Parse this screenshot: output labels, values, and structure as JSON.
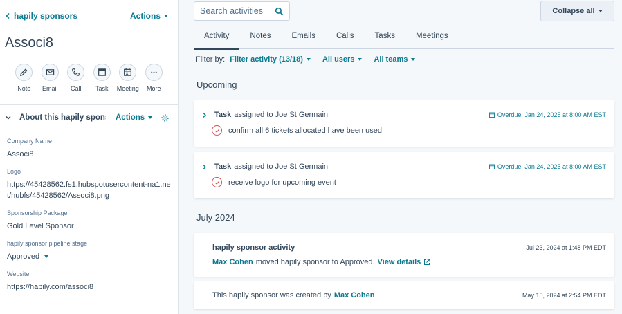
{
  "sidebar": {
    "back_label": "hapily sponsors",
    "actions_label": "Actions",
    "record_name": "Associ8",
    "quick_actions": [
      {
        "label": "Note",
        "icon": "note-icon"
      },
      {
        "label": "Email",
        "icon": "email-icon"
      },
      {
        "label": "Call",
        "icon": "call-icon"
      },
      {
        "label": "Task",
        "icon": "task-icon"
      },
      {
        "label": "Meeting",
        "icon": "meeting-icon"
      },
      {
        "label": "More",
        "icon": "more-icon"
      }
    ],
    "about": {
      "title": "About this hapily sponsor",
      "actions_label": "Actions"
    },
    "properties": [
      {
        "label": "Company Name",
        "value": "Associ8"
      },
      {
        "label": "Logo",
        "value": "https://45428562.fs1.hubspotusercontent-na1.net/hubfs/45428562/Associ8.png"
      },
      {
        "label": "Sponsorship Package",
        "value": "Gold Level Sponsor"
      },
      {
        "label": "hapily sponsor pipeline stage",
        "value": "Approved"
      },
      {
        "label": "Website",
        "value": "https://hapily.com/associ8"
      }
    ]
  },
  "main": {
    "search_placeholder": "Search activities",
    "collapse_label": "Collapse all",
    "tabs": [
      "Activity",
      "Notes",
      "Emails",
      "Calls",
      "Tasks",
      "Meetings"
    ],
    "active_tab": "Activity",
    "filter_by_label": "Filter by:",
    "filters": [
      "Filter activity (13/18)",
      "All users",
      "All teams"
    ],
    "sections": {
      "upcoming": "Upcoming",
      "july": "July 2024"
    },
    "tasks": [
      {
        "kind": "Task",
        "assigned_text": "assigned to Joe St Germain",
        "due": "Overdue: Jan 24, 2025 at 8:00 AM EST",
        "description": "confirm all 6 tickets allocated have been used"
      },
      {
        "kind": "Task",
        "assigned_text": "assigned to Joe St Germain",
        "due": "Overdue: Jan 24, 2025 at 8:00 AM EST",
        "description": "receive logo for upcoming event"
      }
    ],
    "activity": {
      "title": "hapily sponsor activity",
      "date": "Jul 23, 2024 at 1:48 PM EDT",
      "actor": "Max Cohen",
      "text": "moved hapily sponsor to Approved.",
      "link": "View details"
    },
    "created": {
      "text": "This hapily sponsor was created by",
      "actor": "Max Cohen",
      "date": "May 15, 2024 at 2:54 PM EDT"
    }
  },
  "colors": {
    "link": "#0b7a91",
    "text": "#33475b",
    "background": "#f5f8fa",
    "overdue_circle": "#d94b4b"
  }
}
